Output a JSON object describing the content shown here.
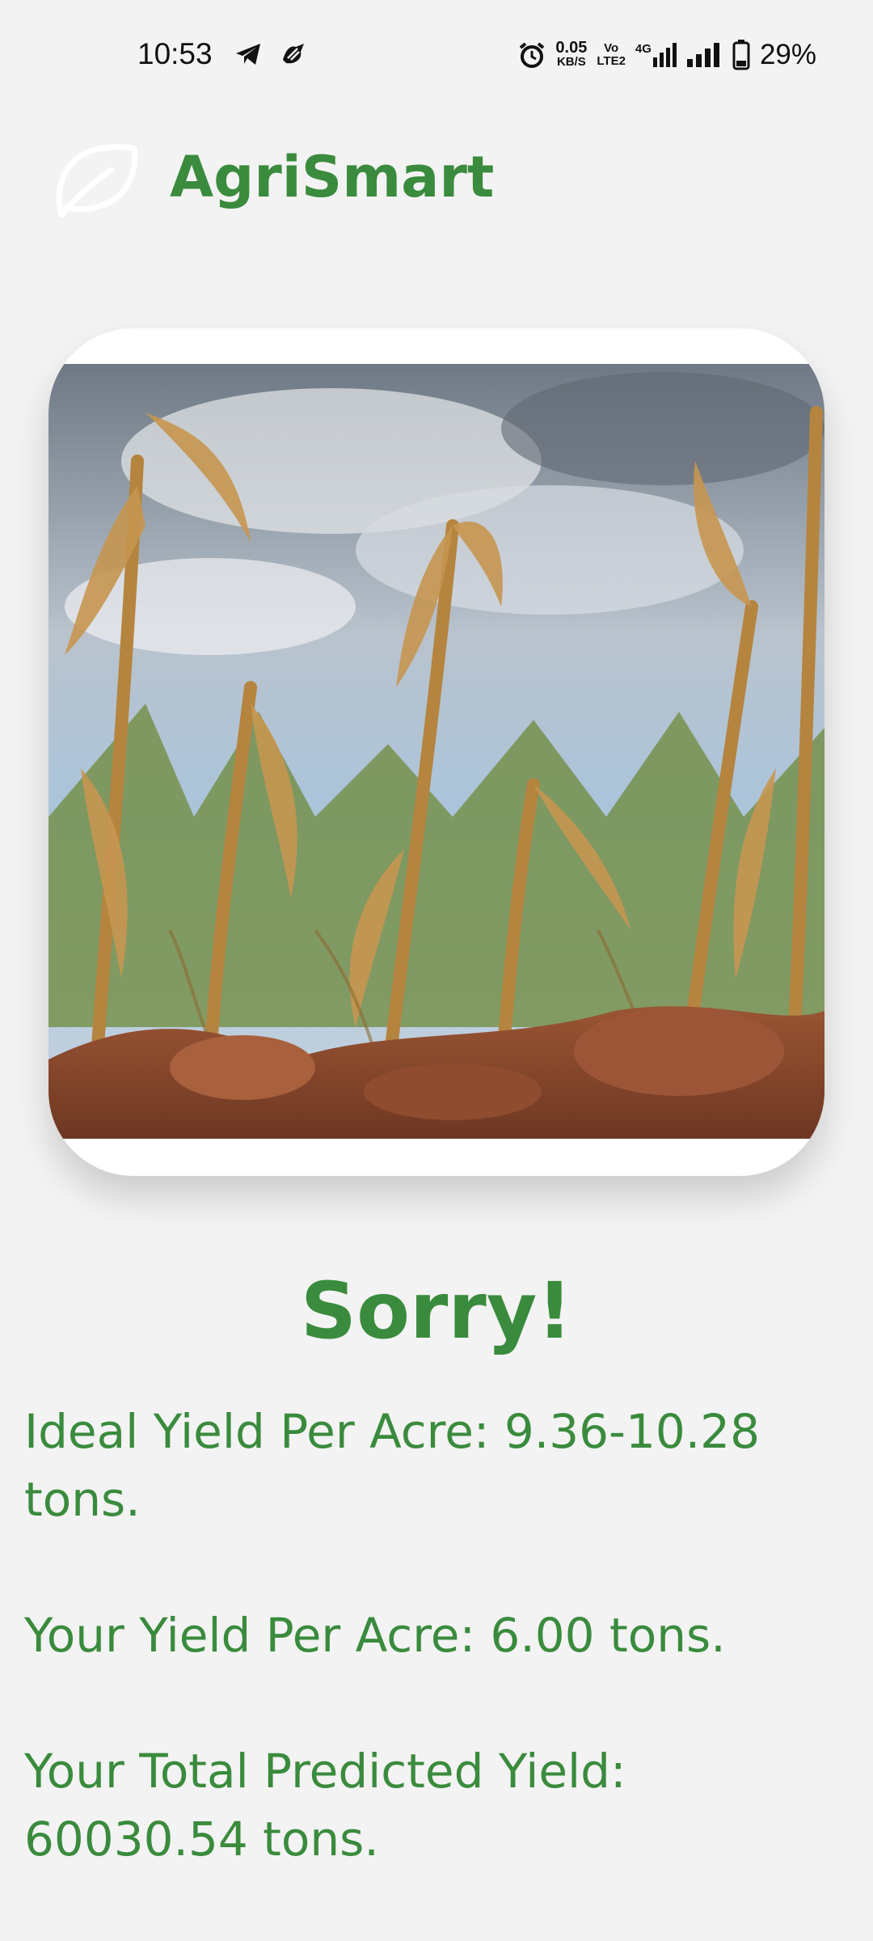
{
  "status_bar": {
    "time": "10:53",
    "net_speed_value": "0.05",
    "net_speed_unit": "KB/S",
    "volte_top": "Vo",
    "volte_bottom": "LTE2",
    "network_type": "4G",
    "battery": "29%"
  },
  "header": {
    "app_name": "AgriSmart",
    "logo_icon": "leaf-icon"
  },
  "image": {
    "subject": "drought-damaged-corn-field",
    "colors": {
      "sky": "#9fb4c6",
      "soil": "#8b4a2c",
      "stalks": "#b98a45"
    }
  },
  "result": {
    "title": "Sorry!",
    "ideal_yield_line1": "Ideal Yield Per Acre: 9.36-10.28",
    "ideal_yield_line2": "tons.",
    "your_yield": "Your Yield Per Acre: 6.00 tons.",
    "total_line1": "Your Total Predicted Yield:",
    "total_line2": "60030.54 tons."
  },
  "colors": {
    "brand_green": "#3a8b3d",
    "background": "#f3f3f3"
  }
}
